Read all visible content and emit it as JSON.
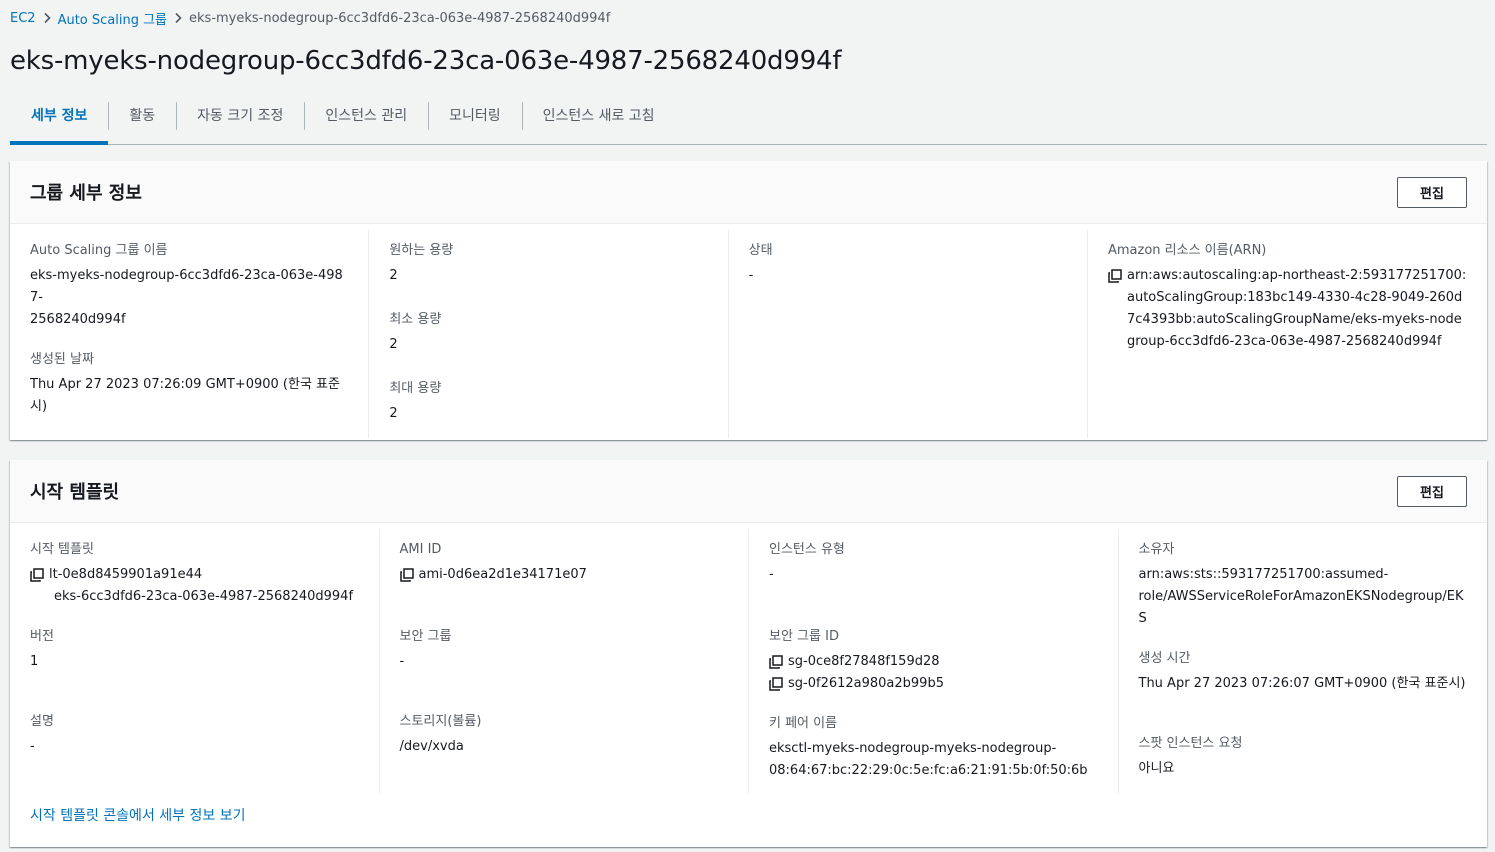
{
  "breadcrumb": {
    "ec2": "EC2",
    "asg": "Auto Scaling 그룹",
    "current": "eks-myeks-nodegroup-6cc3dfd6-23ca-063e-4987-2568240d994f"
  },
  "page_title": "eks-myeks-nodegroup-6cc3dfd6-23ca-063e-4987-2568240d994f",
  "tabs": [
    {
      "label": "세부 정보",
      "active": true
    },
    {
      "label": "활동"
    },
    {
      "label": "자동 크기 조정"
    },
    {
      "label": "인스턴스 관리"
    },
    {
      "label": "모니터링"
    },
    {
      "label": "인스턴스 새로 고침"
    }
  ],
  "group_details": {
    "title": "그룹 세부 정보",
    "edit_label": "편집",
    "asg_name_label": "Auto Scaling 그룹 이름",
    "asg_name_line1": "eks-myeks-nodegroup-6cc3dfd6-23ca-063e-4987-",
    "asg_name_line2": "2568240d994f",
    "created_label": "생성된 날짜",
    "created_value": "Thu Apr 27 2023 07:26:09 GMT+0900 (한국 표준시)",
    "desired_label": "원하는 용량",
    "desired_value": "2",
    "min_label": "최소 용량",
    "min_value": "2",
    "max_label": "최대 용량",
    "max_value": "2",
    "status_label": "상태",
    "status_value": "-",
    "arn_label": "Amazon 리소스 이름(ARN)",
    "arn_value": "arn:aws:autoscaling:ap-northeast-2:593177251700:autoScalingGroup:183bc149-4330-4c28-9049-260d7c4393bb:autoScalingGroupName/eks-myeks-nodegroup-6cc3dfd6-23ca-063e-4987-2568240d994f"
  },
  "launch_template": {
    "title": "시작 템플릿",
    "edit_label": "편집",
    "lt_label": "시작 템플릿",
    "lt_id": "lt-0e8d8459901a91e44",
    "lt_name": "eks-6cc3dfd6-23ca-063e-4987-2568240d994f",
    "version_label": "버전",
    "version_value": "1",
    "desc_label": "설명",
    "desc_value": "-",
    "ami_label": "AMI ID",
    "ami_value": "ami-0d6ea2d1e34171e07",
    "sg_label": "보안 그룹",
    "sg_value": "-",
    "storage_label": "스토리지(볼륨)",
    "storage_value": "/dev/xvda",
    "instance_type_label": "인스턴스 유형",
    "instance_type_value": "-",
    "sg_id_label": "보안 그룹 ID",
    "sg_id_1": "sg-0ce8f27848f159d28",
    "sg_id_2": "sg-0f2612a980a2b99b5",
    "keypair_label": "키 페어 이름",
    "keypair_line1": "eksctl-myeks-nodegroup-myeks-nodegroup-",
    "keypair_line2": "08:64:67:bc:22:29:0c:5e:fc:a6:21:91:5b:0f:50:6b",
    "owner_label": "소유자",
    "owner_line1": "arn:aws:sts::593177251700:assumed-",
    "owner_line2": "role/AWSServiceRoleForAmazonEKSNodegroup/EKS",
    "created_time_label": "생성 시간",
    "created_time_value": "Thu Apr 27 2023 07:26:07 GMT+0900 (한국 표준시)",
    "spot_label": "스팟 인스턴스 요청",
    "spot_value": "아니요",
    "console_link": "시작 템플릿 콘솔에서 세부 정보 보기"
  },
  "colors": {
    "link": "#0073bb",
    "text": "#16191f",
    "label": "#545b64",
    "background": "#f2f3f3"
  }
}
